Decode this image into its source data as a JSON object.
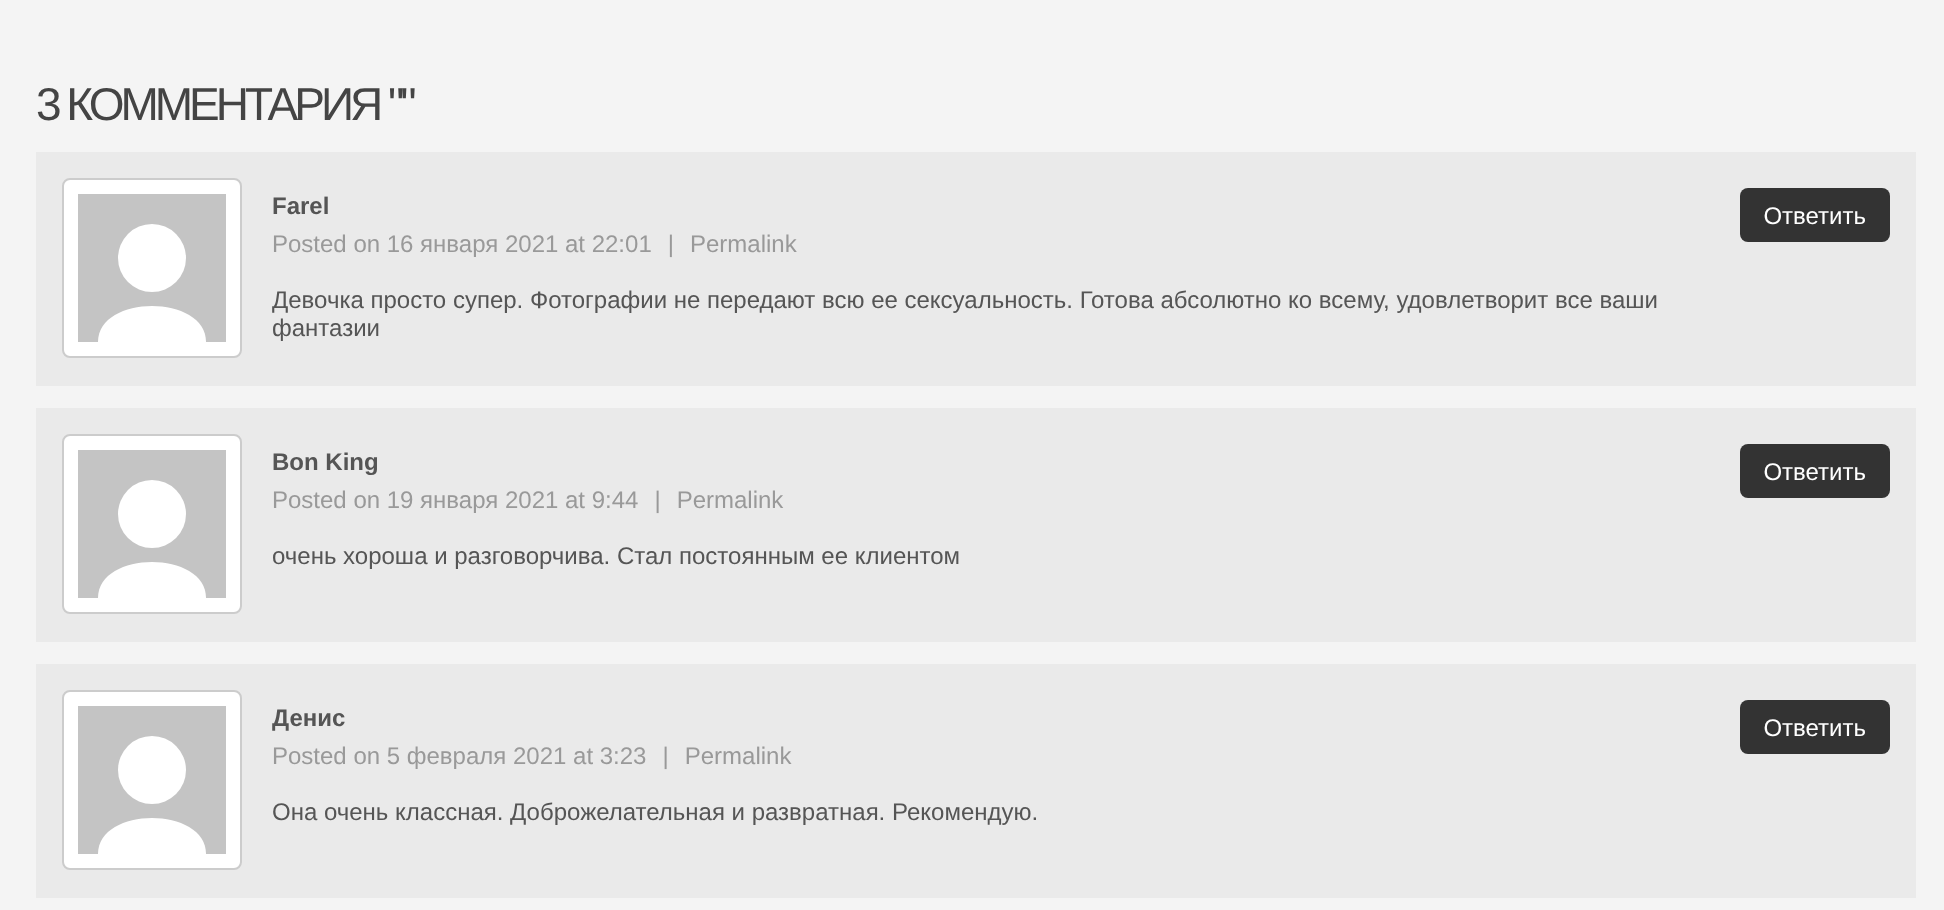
{
  "heading": "3 КОММЕНТАРИЯ \"\"",
  "comments": [
    {
      "author": "Farel",
      "posted": "Posted on 16 января 2021 at 22:01",
      "separator": "|",
      "permalink": "Permalink",
      "text": "Девочка просто супер. Фотографии не передают всю ее сексуальность. Готова абсолютно ко всему, удовлетворит все ваши фантазии",
      "reply": "Ответить"
    },
    {
      "author": "Bon King",
      "posted": "Posted on 19 января 2021 at 9:44",
      "separator": "|",
      "permalink": "Permalink",
      "text": "очень хороша и разговорчива. Стал постоянным ее клиентом",
      "reply": "Ответить"
    },
    {
      "author": "Денис",
      "posted": "Posted on 5 февраля 2021 at 3:23",
      "separator": "|",
      "permalink": "Permalink",
      "text": "Она очень классная. Доброжелательная и развратная. Рекомендую.",
      "reply": "Ответить"
    }
  ]
}
